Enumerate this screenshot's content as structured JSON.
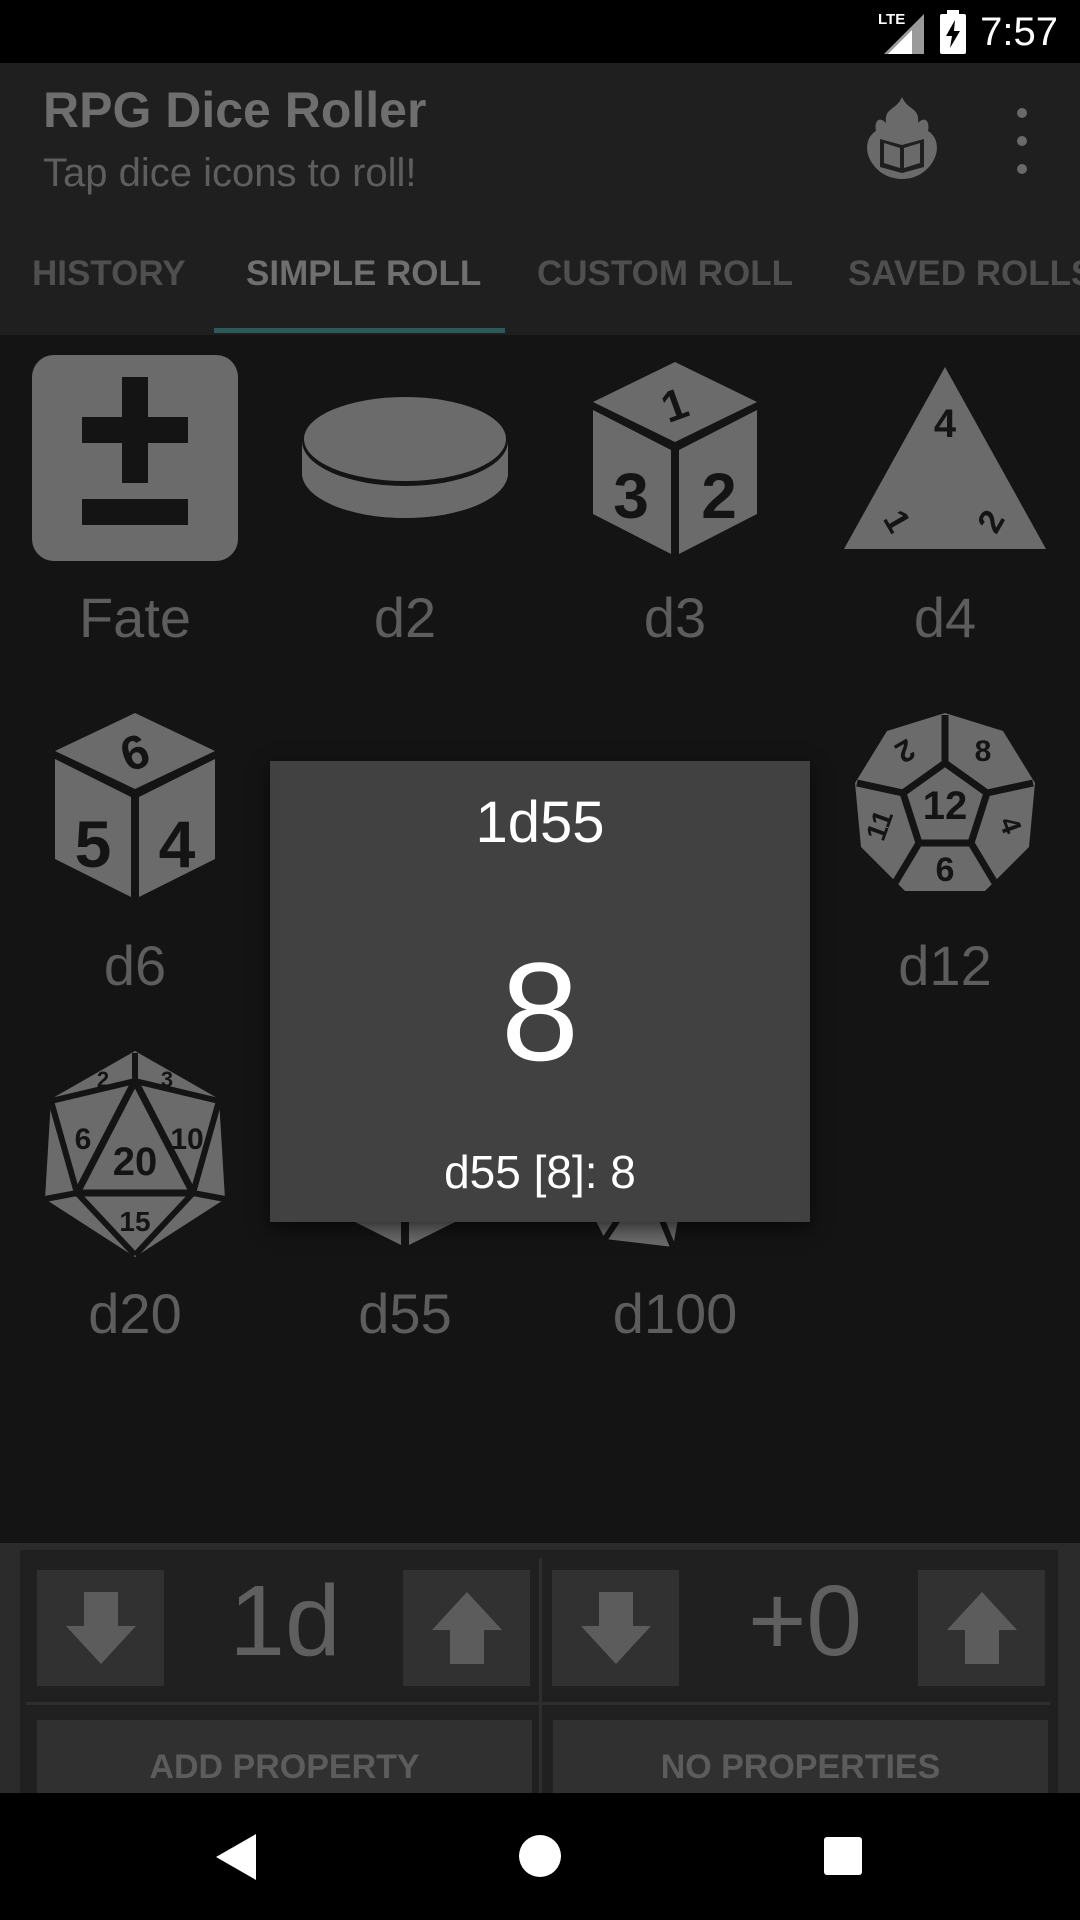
{
  "status": {
    "network": "LTE",
    "time": "7:57"
  },
  "appbar": {
    "title": "RPG Dice Roller",
    "subtitle": "Tap dice icons to roll!"
  },
  "tabs": [
    {
      "label": "HISTORY",
      "active": false
    },
    {
      "label": "SIMPLE ROLL",
      "active": true
    },
    {
      "label": "CUSTOM ROLL",
      "active": false
    },
    {
      "label": "SAVED ROLLS",
      "active": false
    }
  ],
  "dice": [
    {
      "label": "Fate",
      "icon": "plus-minus-icon"
    },
    {
      "label": "d2",
      "icon": "coin-icon"
    },
    {
      "label": "d3",
      "icon": "d3-cube-icon"
    },
    {
      "label": "d4",
      "icon": "d4-tetrahedron-icon"
    },
    {
      "label": "d6",
      "icon": "d6-cube-icon"
    },
    {
      "label": "d12",
      "icon": "d12-dodecahedron-icon"
    },
    {
      "label": "d20",
      "icon": "d20-icosahedron-icon"
    },
    {
      "label": "d55",
      "icon": "custom-die-icon"
    },
    {
      "label": "d100",
      "icon": "d100-dice-icon"
    }
  ],
  "controls": {
    "count": "1d",
    "modifier": "+0",
    "add_property": "ADD PROPERTY",
    "properties": "NO PROPERTIES"
  },
  "dialog": {
    "title": "1d55",
    "result": "8",
    "detail": "d55 [8]: 8"
  },
  "colors": {
    "indicator": "#2c5a5a",
    "dialog_bg": "#414141",
    "icon_gray": "#6b6b6b"
  }
}
